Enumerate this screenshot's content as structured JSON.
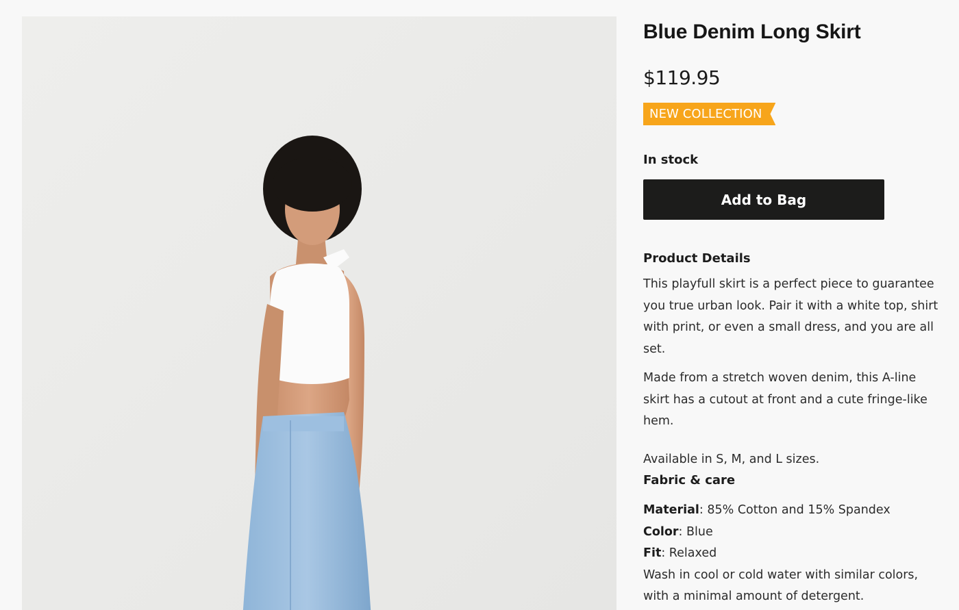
{
  "product": {
    "title": "Blue Denim Long Skirt",
    "price": "$119.95",
    "badge": "NEW COLLECTION",
    "stock_status": "In stock",
    "add_button_label": "Add to Bag"
  },
  "details": {
    "heading": "Product Details",
    "paragraph_1": "This playfull skirt is a perfect piece to guarantee you true urban look. Pair it with a white top, shirt with print, or even a small dress, and you are all set.",
    "paragraph_2": "Made from a stretch woven denim, this A-line skirt has a cutout at front and a cute fringe-like hem.",
    "sizes": "Available in S, M, and L sizes."
  },
  "fabric_care": {
    "heading": "Fabric & care",
    "specs": [
      {
        "label": "Material",
        "value": ": 85% Cotton and 15% Spandex"
      },
      {
        "label": "Color",
        "value": ": Blue"
      },
      {
        "label": "Fit",
        "value": ": Relaxed"
      }
    ],
    "care_text": "Wash in cool or cold water with similar colors, with a minimal amount of detergent."
  },
  "colors": {
    "badge": "#f7a51b",
    "button": "#1c1c1b",
    "background": "#f8f8f8"
  }
}
